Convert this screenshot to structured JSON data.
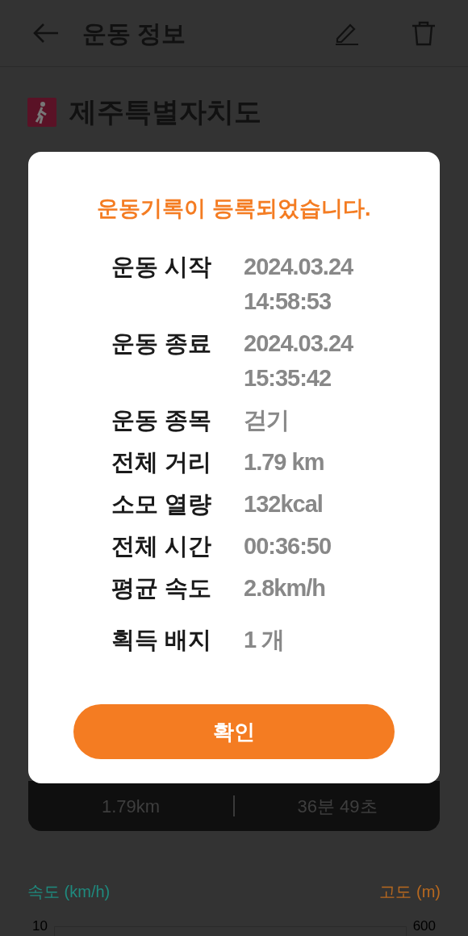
{
  "app_bar": {
    "title": "운동 정보"
  },
  "location": {
    "name": "제주특별자치도"
  },
  "summary_card": {
    "distance": "1.79km",
    "duration": "36분 49초"
  },
  "chart": {
    "left_label": "속도 (km/h)",
    "right_label": "고도 (m)",
    "left_top_tick": "10",
    "right_top_tick": "600"
  },
  "dialog": {
    "title": "운동기록이 등록되었습니다.",
    "rows": [
      {
        "label": "운동 시작",
        "value": [
          "2024.03.24",
          "14:58:53"
        ]
      },
      {
        "label": "운동 종료",
        "value": [
          "2024.03.24",
          "15:35:42"
        ]
      },
      {
        "label": "운동 종목",
        "value": [
          "걷기"
        ]
      },
      {
        "label": "전체 거리",
        "value": [
          "1.79 km"
        ]
      },
      {
        "label": "소모 열량",
        "value": [
          "132kcal"
        ]
      },
      {
        "label": "전체 시간",
        "value": [
          "00:36:50"
        ]
      },
      {
        "label": "평균 속도",
        "value": [
          "2.8km/h"
        ]
      },
      {
        "label": "획득 배지",
        "value": [
          "1 개"
        ]
      }
    ],
    "confirm_button": "확인"
  }
}
